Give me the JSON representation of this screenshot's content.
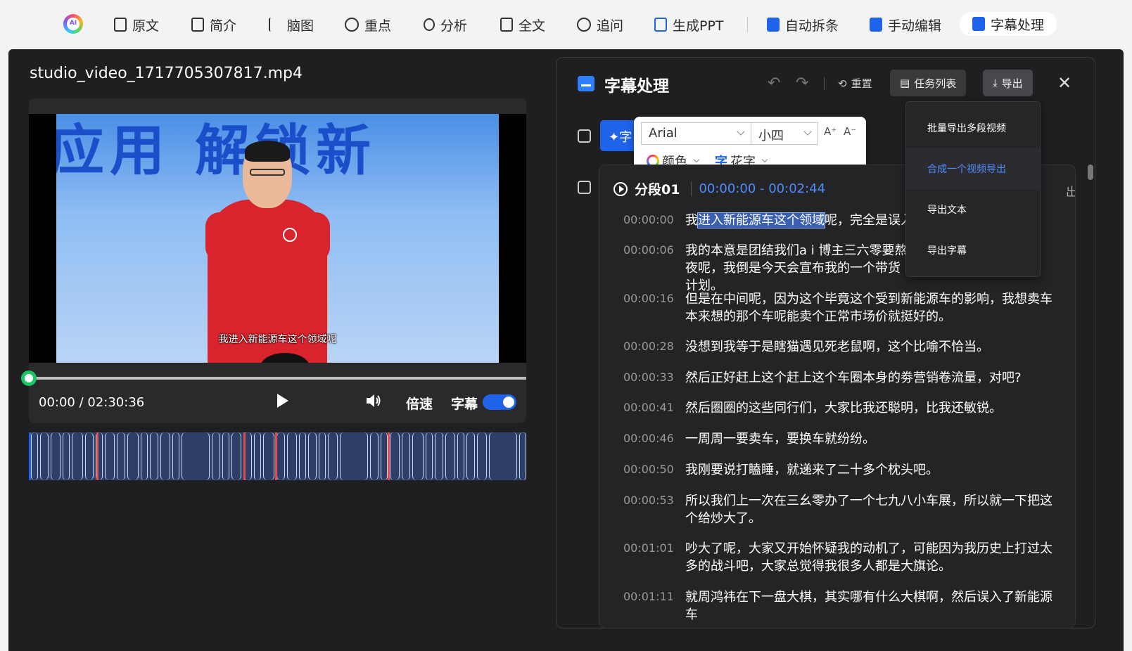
{
  "nav": {
    "logo_text": "AI",
    "items": [
      {
        "label": "原文",
        "icon": "document-icon"
      },
      {
        "label": "简介",
        "icon": "clipboard-icon"
      },
      {
        "label": "脑图",
        "icon": "mindmap-icon"
      },
      {
        "label": "重点",
        "icon": "star-circle-icon"
      },
      {
        "label": "分析",
        "icon": "lightbulb-icon"
      },
      {
        "label": "全文",
        "icon": "page-icon"
      },
      {
        "label": "追问",
        "icon": "chat-icon"
      },
      {
        "label": "生成PPT",
        "icon": "ppt-icon"
      },
      {
        "label": "自动拆条",
        "icon": "film-icon"
      },
      {
        "label": "手动编辑",
        "icon": "edit-video-icon"
      },
      {
        "label": "字幕处理",
        "icon": "subtitle-icon",
        "active": true
      }
    ]
  },
  "player": {
    "filename": "studio_video_1717705307817.mp4",
    "banner_text": "应用 解锁新",
    "caption": "我进入新能源车这个领域呢",
    "time": "00:00 / 02:30:36",
    "speed_label": "倍速",
    "subtitle_label": "字幕",
    "subtitle_on": true,
    "progress": 0
  },
  "panel": {
    "title": "字幕处理",
    "reset_label": "重置",
    "task_list_label": "任务列表",
    "export_label": "导出",
    "ai_btn_text": "✦字",
    "font_popup": {
      "font": "Arial",
      "size": "小四",
      "increase": "A⁺",
      "decrease": "A⁻",
      "color_label": "颜色",
      "fancy_icon": "字",
      "fancy_label": "花字"
    },
    "export_menu": [
      {
        "label": "批量导出多段视频"
      },
      {
        "label": "合成一个视频导出",
        "active": true
      },
      {
        "label": "导出文本"
      },
      {
        "label": "导出字幕"
      }
    ],
    "segment": {
      "name": "分段01",
      "range": "00:00:00 - 00:02:44",
      "export_fragment": "出",
      "lines": [
        {
          "ts": "00:00:00",
          "pre": "我",
          "hl": "进入新能源车这个领域",
          "post": "呢，完全是误入，"
        },
        {
          "ts": "00:00:06",
          "text": "我的本意是团结我们a i 博主三六零要熬夜呢，我倒是今天会宣布我的一个带货计划。"
        },
        {
          "ts": "00:00:16",
          "text": "但是在中间呢，因为这个毕竟这个受到新能源车的影响，我想卖车本来想的那个车呢能卖个正常市场价就挺好的。"
        },
        {
          "ts": "00:00:28",
          "text": "没想到我等于是瞎猫遇见死老鼠啊，这个比喻不恰当。"
        },
        {
          "ts": "00:00:33",
          "text": "然后正好赶上这个赶上这个车圈本身的劵营销卷流量，对吧?"
        },
        {
          "ts": "00:00:41",
          "text": "然后圈圈的这些同行们，大家比我还聪明，比我还敏锐。"
        },
        {
          "ts": "00:00:46",
          "text": "一周周一要卖车，要换车就纷纷。"
        },
        {
          "ts": "00:00:50",
          "text": "我刚要说打瞌睡，就递来了二十多个枕头吧。"
        },
        {
          "ts": "00:00:53",
          "text": "所以我们上一次在三幺零办了一个七九八小车展，所以就一下把这个给炒大了。"
        },
        {
          "ts": "00:01:01",
          "text": "吵大了呢，大家又开始怀疑我的动机了，可能因为我历史上打过太多的战斗吧，大家总觉得我很多人都是大旗论。"
        },
        {
          "ts": "00:01:11",
          "text": "就周鸿祎在下一盘大棋，其实哪有什么大棋啊，然后误入了新能源车"
        }
      ]
    }
  },
  "colors": {
    "accent": "#1e63e9",
    "progress_knob": "#17c964",
    "dark_bg": "#1f1f21"
  }
}
